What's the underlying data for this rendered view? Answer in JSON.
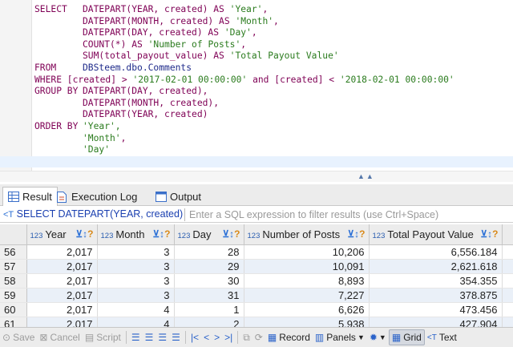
{
  "editor": {
    "lines": [
      {
        "a": "SELECT",
        "b": [
          "DATEPART(YEAR, created) AS ",
          "'Year'",
          ","
        ]
      },
      {
        "a": "",
        "b": [
          "DATEPART(MONTH, created) AS ",
          "'Month'",
          ","
        ]
      },
      {
        "a": "",
        "b": [
          "DATEPART(DAY, created) AS ",
          "'Day'",
          ","
        ]
      },
      {
        "a": "",
        "b": [
          "COUNT(*) AS ",
          "'Number of Posts'",
          ","
        ]
      },
      {
        "a": "",
        "b": [
          "SUM(total_payout_value) AS ",
          "'Total Payout Value'",
          ""
        ]
      },
      {
        "a": "FROM",
        "b": [
          "DBSteem.dbo.Comments",
          "",
          ""
        ]
      },
      {
        "a": "",
        "raw": [
          "WHERE [created] > ",
          "'2017-02-01 00:00:00'",
          " and [created] < ",
          "'2018-02-01 00:00:00'"
        ]
      },
      {
        "a": "",
        "raw2": [
          "GROUP BY",
          "DATEPART(DAY, created),"
        ]
      },
      {
        "a": "",
        "b": [
          "DATEPART(MONTH, created),",
          "",
          ""
        ]
      },
      {
        "a": "",
        "b": [
          "DATEPART(YEAR, created)",
          "",
          ""
        ]
      },
      {
        "a": "",
        "raw2": [
          "ORDER BY",
          "'Year',"
        ]
      },
      {
        "a": "",
        "b": [
          "",
          "'Month'",
          ","
        ]
      },
      {
        "a": "",
        "b": [
          "",
          "'Day'",
          ""
        ]
      },
      {
        "a": "",
        "b": [
          "",
          "",
          ""
        ]
      }
    ]
  },
  "tabs": [
    {
      "label": "Result",
      "icon": "grid-icon",
      "active": true
    },
    {
      "label": "Execution Log",
      "icon": "document-icon",
      "active": false
    },
    {
      "label": "Output",
      "icon": "console-icon",
      "active": false
    }
  ],
  "filter": {
    "query_prefix": "<T",
    "query": "SELECT DATEPART(YEAR, created) /",
    "placeholder": "Enter a SQL expression to filter results (use Ctrl+Space)"
  },
  "grid": {
    "type_tag": "123",
    "columns": [
      "Year",
      "Month",
      "Day",
      "Number of Posts",
      "Total Payout Value"
    ],
    "rows": [
      {
        "n": "56",
        "cells": [
          "2,017",
          "3",
          "28",
          "10,206",
          "6,556.184"
        ]
      },
      {
        "n": "57",
        "cells": [
          "2,017",
          "3",
          "29",
          "10,091",
          "2,621.618"
        ]
      },
      {
        "n": "58",
        "cells": [
          "2,017",
          "3",
          "30",
          "8,893",
          "354.355"
        ]
      },
      {
        "n": "59",
        "cells": [
          "2,017",
          "3",
          "31",
          "7,227",
          "378.875"
        ]
      },
      {
        "n": "60",
        "cells": [
          "2,017",
          "4",
          "1",
          "6,626",
          "473.456"
        ]
      },
      {
        "n": "61",
        "cells": [
          "2,017",
          "4",
          "2",
          "5,938",
          "427.904"
        ]
      }
    ]
  },
  "toolbar": {
    "save": "Save",
    "cancel": "Cancel",
    "script": "Script",
    "record": "Record",
    "panels": "Panels",
    "grid": "Grid",
    "text": "Text"
  }
}
